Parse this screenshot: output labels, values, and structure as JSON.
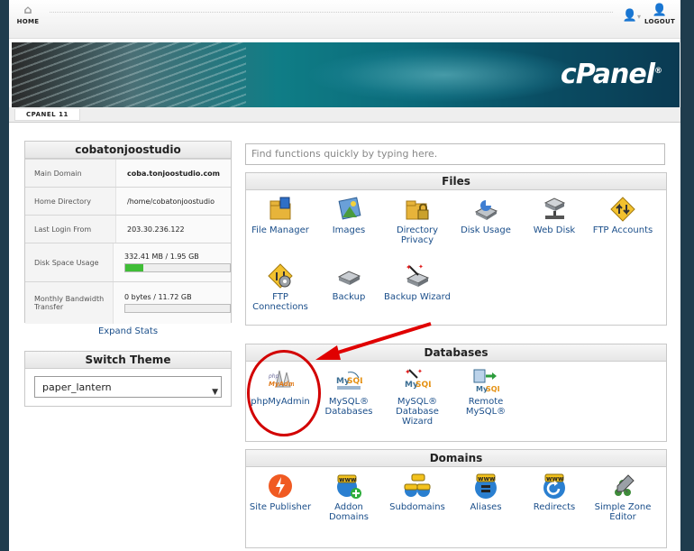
{
  "topbar": {
    "home_label": "HOME",
    "logout_label": "LOGOUT"
  },
  "banner": {
    "brand": "cPanel"
  },
  "version_tab": "CPANEL 11",
  "stats": {
    "title": "cobatonjoostudio",
    "rows": [
      {
        "label": "Main Domain",
        "value": "coba.tonjoostudio.com"
      },
      {
        "label": "Home Directory",
        "value": "/home/cobatonjoostudio"
      },
      {
        "label": "Last Login From",
        "value": "203.30.236.122"
      },
      {
        "label": "Disk Space Usage",
        "value": "332.41 MB / 1.95 GB",
        "usage_fraction": 0.17
      },
      {
        "label": "Monthly Bandwidth Transfer",
        "value": "0 bytes / 11.72 GB",
        "usage_fraction": 0.0
      }
    ],
    "expand_label": "Expand Stats"
  },
  "theme": {
    "title": "Switch Theme",
    "selected": "paper_lantern"
  },
  "search": {
    "placeholder": "Find functions quickly by typing here."
  },
  "files": {
    "title": "Files",
    "items": [
      {
        "label": "File Manager",
        "icon": "file-manager-icon"
      },
      {
        "label": "Images",
        "icon": "images-icon"
      },
      {
        "label": "Directory Privacy",
        "icon": "directory-privacy-icon"
      },
      {
        "label": "Disk Usage",
        "icon": "disk-usage-icon"
      },
      {
        "label": "Web Disk",
        "icon": "web-disk-icon"
      },
      {
        "label": "FTP Accounts",
        "icon": "ftp-accounts-icon"
      },
      {
        "label": "FTP Connections",
        "icon": "ftp-connections-icon"
      },
      {
        "label": "Backup",
        "icon": "backup-icon"
      },
      {
        "label": "Backup Wizard",
        "icon": "backup-wizard-icon"
      }
    ]
  },
  "databases": {
    "title": "Databases",
    "items": [
      {
        "label": "phpMyAdmin",
        "icon": "phpmyadmin-icon"
      },
      {
        "label": "MySQL® Databases",
        "icon": "mysql-databases-icon"
      },
      {
        "label": "MySQL® Database Wizard",
        "icon": "mysql-wizard-icon"
      },
      {
        "label": "Remote MySQL®",
        "icon": "remote-mysql-icon"
      }
    ]
  },
  "domains": {
    "title": "Domains",
    "items": [
      {
        "label": "Site Publisher",
        "icon": "site-publisher-icon"
      },
      {
        "label": "Addon Domains",
        "icon": "addon-domains-icon"
      },
      {
        "label": "Subdomains",
        "icon": "subdomains-icon"
      },
      {
        "label": "Aliases",
        "icon": "aliases-icon"
      },
      {
        "label": "Redirects",
        "icon": "redirects-icon"
      },
      {
        "label": "Simple Zone Editor",
        "icon": "simple-zone-editor-icon"
      }
    ]
  },
  "colors": {
    "link": "#1a4e8a",
    "annotation": "#d20000",
    "usage_bar": "#3fbd36"
  }
}
